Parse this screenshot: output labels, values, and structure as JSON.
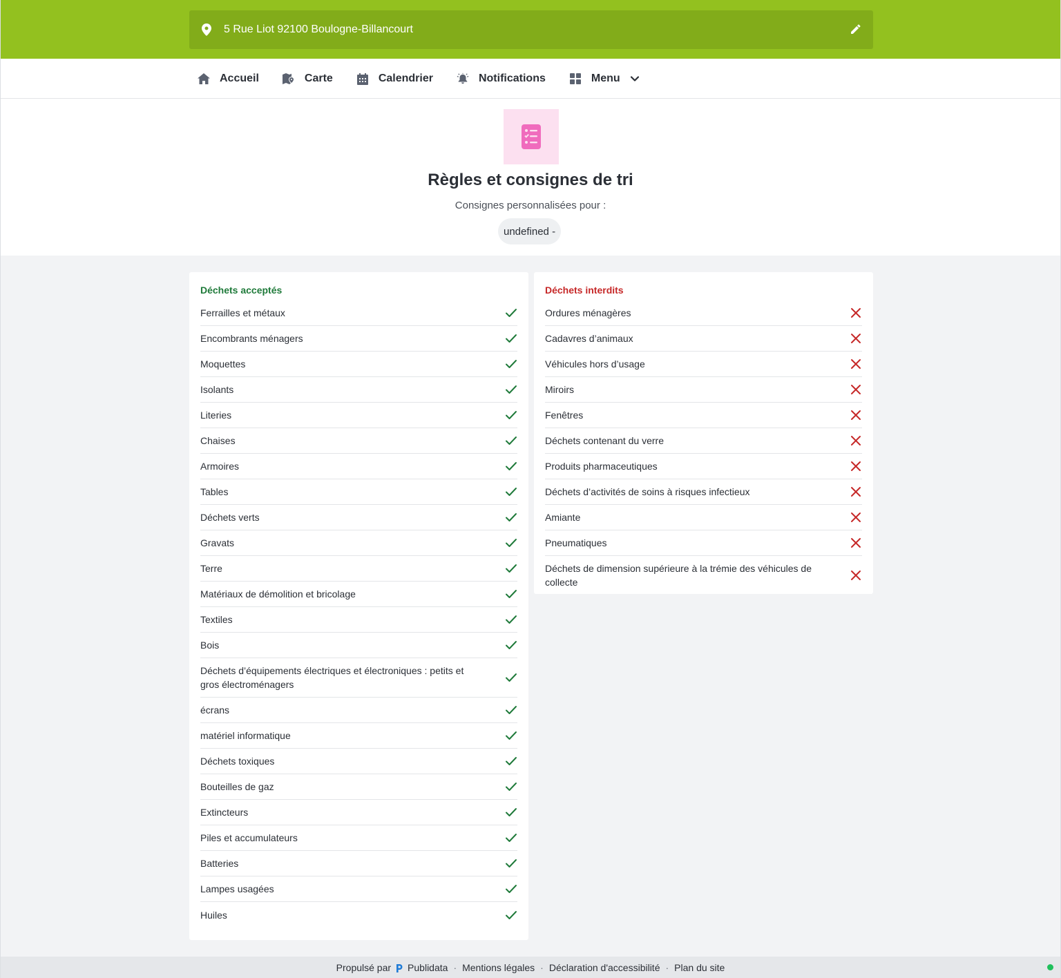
{
  "address": {
    "text": "5 Rue Liot 92100 Boulogne-Billancourt",
    "pin_icon": "map-pin-icon",
    "edit_icon": "pencil-icon"
  },
  "nav": [
    {
      "label": "Accueil",
      "icon": "home-icon"
    },
    {
      "label": "Carte",
      "icon": "map-icon"
    },
    {
      "label": "Calendrier",
      "icon": "calendar-icon"
    },
    {
      "label": "Notifications",
      "icon": "bell-icon"
    },
    {
      "label": "Menu",
      "icon": "grid-icon"
    }
  ],
  "header": {
    "title": "Règles et consignes de tri",
    "subtitle": "Consignes personnalisées pour :",
    "chip": "undefined -",
    "icon": "checklist-icon"
  },
  "accepted": {
    "title": "Déchets acceptés",
    "items": [
      "Ferrailles et métaux",
      "Encombrants ménagers",
      "Moquettes",
      "Isolants",
      "Literies",
      "Chaises",
      "Armoires",
      "Tables",
      "Déchets verts",
      "Gravats",
      "Terre",
      "Matériaux de démolition et bricolage",
      "Textiles",
      "Bois",
      "Déchets d’équipements électriques et électroniques : petits et gros électroménagers",
      "écrans",
      "matériel informatique",
      "Déchets toxiques",
      "Bouteilles de gaz",
      "Extincteurs",
      "Piles et accumulateurs",
      "Batteries",
      "Lampes usagées",
      "Huiles"
    ]
  },
  "forbidden": {
    "title": "Déchets interdits",
    "items": [
      "Ordures ménagères",
      "Cadavres d’animaux",
      "Véhicules hors d’usage",
      "Miroirs",
      "Fenêtres",
      "Déchets contenant du verre",
      "Produits pharmaceutiques",
      "Déchets d’activités de soins à risques infectieux",
      "Amiante",
      "Pneumatiques",
      "Déchets de dimension supérieure à la trémie des véhicules de collecte"
    ]
  },
  "footer": {
    "powered_by": "Propulsé par",
    "brand": "Publidata",
    "links": [
      "Mentions légales",
      "Déclaration d'accessibilité",
      "Plan du site"
    ]
  },
  "colors": {
    "topbar": "#93c11f",
    "address_bar": "#82ac1a",
    "accepted": "#1f7a3a",
    "forbidden": "#c62828",
    "icon_tile": "#fce0f0",
    "icon_pink": "#f06bbd",
    "status_dot": "#20c05c"
  }
}
